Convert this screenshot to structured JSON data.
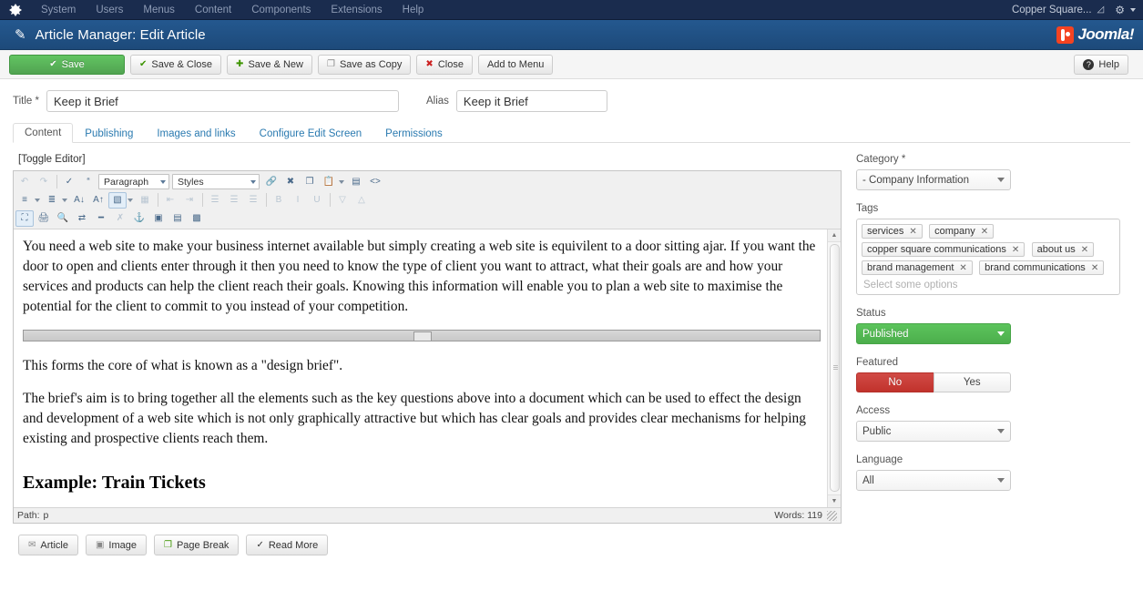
{
  "topbar": {
    "brand_icon": "joomla-mark-icon",
    "menu": [
      {
        "label": "System"
      },
      {
        "label": "Users"
      },
      {
        "label": "Menus"
      },
      {
        "label": "Content"
      },
      {
        "label": "Components"
      },
      {
        "label": "Extensions"
      },
      {
        "label": "Help"
      }
    ],
    "site_name": "Copper Square...",
    "external_link_icon": "external-link-icon",
    "gear_icon": "gear-icon"
  },
  "header": {
    "icon": "pencil-icon",
    "title": "Article Manager: Edit Article",
    "logo_text": "Joomla!"
  },
  "toolbar": {
    "save_label": "Save",
    "save_close_label": "Save & Close",
    "save_new_label": "Save & New",
    "save_copy_label": "Save as Copy",
    "close_label": "Close",
    "add_menu_label": "Add to Menu",
    "help_label": "Help",
    "icons": {
      "save": "✔",
      "save_close": "✔",
      "save_new": "✚",
      "save_copy": "❐",
      "close": "✖",
      "help": "?"
    }
  },
  "form": {
    "title_label": "Title *",
    "title_value": "Keep it Brief",
    "title_placeholder": "",
    "alias_label": "Alias",
    "alias_value": "Keep it Brief",
    "alias_placeholder": ""
  },
  "tabs": [
    {
      "label": "Content",
      "active": true
    },
    {
      "label": "Publishing",
      "active": false
    },
    {
      "label": "Images and links",
      "active": false
    },
    {
      "label": "Configure Edit Screen",
      "active": false
    },
    {
      "label": "Permissions",
      "active": false
    }
  ],
  "editor": {
    "toggle_label": "[Toggle Editor]",
    "paragraph_select": "Paragraph",
    "styles_select": "Styles",
    "content": {
      "paragraph_1": "You need a web site to make your business internet available but simply creating a web site is equivilent to a door sitting ajar. If you want the door to open and  clients enter through it then you need to know the type of client you want to attract, what their goals are and how your services and products can help the client reach their goals. Knowing this information will enable you to plan a web site to maximise the potential for the client to commit to you instead of your competition.",
      "paragraph_2": "This forms the core of what is known as a \"design brief\".",
      "paragraph_3": " The brief's aim is to bring together all the elements such as the key questions above into a document which can be used to effect the design and development of a web site which is not only graphically attractive but which has clear goals and provides clear mechanisms for helping existing and prospective clients reach them.",
      "heading_1": "Example: Train Tickets"
    },
    "status": {
      "path_label": "Path:",
      "path_value": "p",
      "words_label": "Words: 119"
    }
  },
  "editor_buttons": [
    {
      "label": "Article",
      "icon": "article-icon"
    },
    {
      "label": "Image",
      "icon": "image-icon"
    },
    {
      "label": "Page Break",
      "icon": "page-break-icon"
    },
    {
      "label": "Read More",
      "icon": "read-more-icon"
    }
  ],
  "sidebar": {
    "category_label": "Category *",
    "category_value": "- Company Information",
    "tags_label": "Tags",
    "tags": [
      "services",
      "company",
      "copper square communications",
      "about us",
      "brand management",
      "brand communications"
    ],
    "tags_placeholder": "Select some options",
    "status_label": "Status",
    "status_value": "Published",
    "featured_label": "Featured",
    "featured_no": "No",
    "featured_yes": "Yes",
    "featured_selected": "No",
    "access_label": "Access",
    "access_value": "Public",
    "language_label": "Language",
    "language_value": "All"
  },
  "colors": {
    "topbar": "#1a2c4e",
    "header": "#24588f",
    "save_green": "#51a351",
    "status_green": "#4cae4c",
    "featured_red": "#c1322c",
    "link_blue": "#2a7ab0"
  }
}
